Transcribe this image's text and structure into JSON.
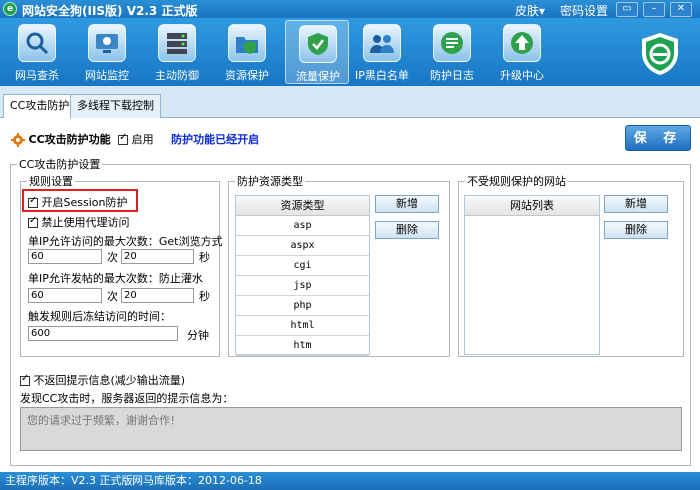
{
  "titlebar": {
    "title": "网站安全狗(IIS版) V2.3 正式版",
    "skin": "皮肤▾",
    "password": "密码设置",
    "menu_glyph": "▭",
    "min_glyph": "–",
    "close_glyph": "✕"
  },
  "toolbar": {
    "items": [
      {
        "label": "网马查杀"
      },
      {
        "label": "网站监控"
      },
      {
        "label": "主动防御"
      },
      {
        "label": "资源保护"
      },
      {
        "label": "流量保护"
      },
      {
        "label": "IP黑白名单"
      },
      {
        "label": "防护日志"
      },
      {
        "label": "升级中心"
      }
    ],
    "active": "流量保护"
  },
  "tabs": [
    {
      "label": "CC攻击防护"
    },
    {
      "label": "多线程下载控制"
    }
  ],
  "header": {
    "feature_label": "CC攻击防护功能",
    "enable_label": "启用",
    "status_note": "防护功能已经开启",
    "save_label": "保 存"
  },
  "cc_settings": {
    "legend": "CC攻击防护设置",
    "rules": {
      "legend": "规则设置",
      "session_label": "开启Session防护",
      "proxy_label": "禁止使用代理访问",
      "max_visits_label": "单IP允许访问的最大次数：Get浏览方式",
      "max_visits_count": "60",
      "max_visits_count_unit": "次",
      "max_visits_seconds": "20",
      "max_visits_seconds_unit": "秒",
      "max_posts_label": "单IP允许发帖的最大次数：防止灌水",
      "max_posts_count": "60",
      "max_posts_count_unit": "次",
      "max_posts_seconds": "20",
      "max_posts_seconds_unit": "秒",
      "freeze_label": "触发规则后冻结访问的时间：",
      "freeze_minutes": "600",
      "freeze_unit": "分钟"
    },
    "resources": {
      "legend": "防护资源类型",
      "column": "资源类型",
      "items": [
        "asp",
        "aspx",
        "cgi",
        "jsp",
        "php",
        "html",
        "htm"
      ],
      "add_label": "新增",
      "delete_label": "删除"
    },
    "exempt": {
      "legend": "不受规则保护的网站",
      "column": "网站列表",
      "add_label": "新增",
      "delete_label": "删除"
    }
  },
  "message": {
    "checkbox_label": "不返回提示信息(减少输出流量)",
    "prompt_label": "发现CC攻击时，服务器返回的提示信息为：",
    "text": "您的请求过于频繁，谢谢合作！"
  },
  "statusbar": {
    "version": "主程序版本：V2.3 正式版",
    "db_version": "网马库版本：2012-06-18"
  }
}
